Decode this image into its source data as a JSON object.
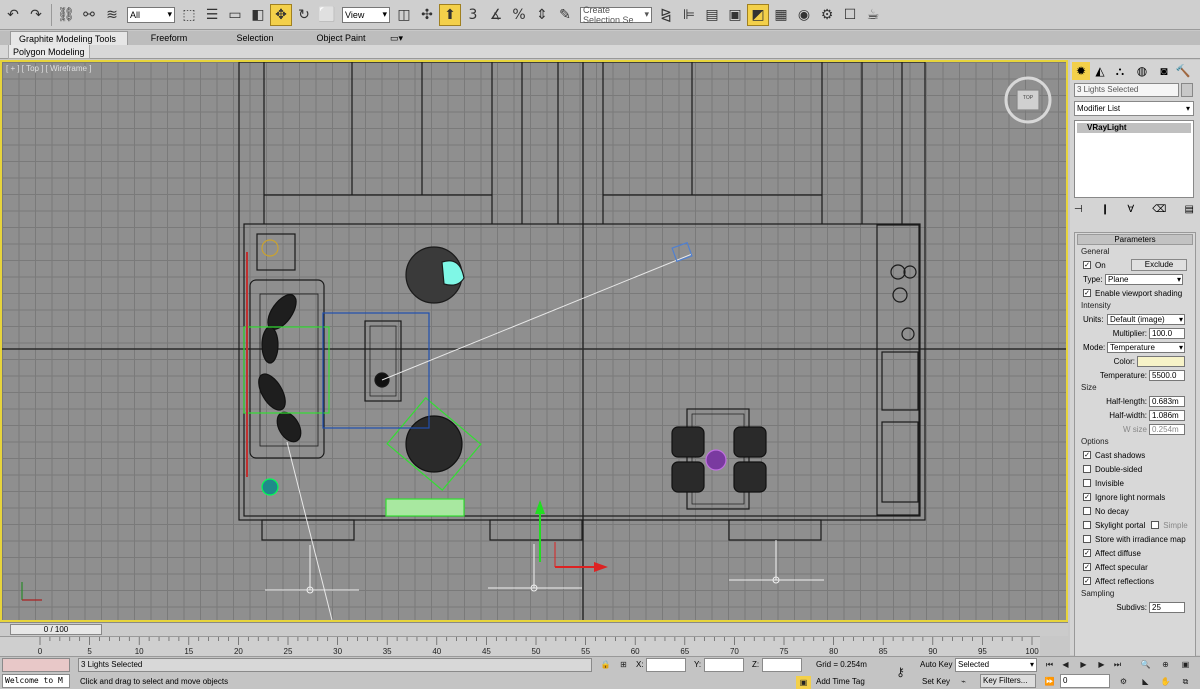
{
  "toolbar": {
    "selection_filter": "All",
    "ref_coord": "View",
    "named_selection_placeholder": "Create Selection Se",
    "snap_labels": [
      "3",
      "%"
    ]
  },
  "ribbon": {
    "tabs": [
      "Graphite Modeling Tools",
      "Freeform",
      "Selection",
      "Object Paint"
    ],
    "active_tab": "Graphite Modeling Tools",
    "sub_label": "Polygon Modeling"
  },
  "viewport": {
    "label": "[ + ] [ Top ] [ Wireframe ]",
    "viewcube_label": "TOP"
  },
  "command_panel": {
    "object_name": "3 Lights Selected",
    "modifier_list": "Modifier List",
    "stack_item": "VRayLight",
    "rollout_title": "Parameters",
    "general": {
      "title": "General",
      "on_label": "On",
      "on_checked": true,
      "exclude_label": "Exclude",
      "type_label": "Type:",
      "type_value": "Plane",
      "viewport_shading_label": "Enable viewport shading",
      "viewport_shading_checked": true
    },
    "intensity": {
      "title": "Intensity",
      "units_label": "Units:",
      "units_value": "Default (image)",
      "multiplier_label": "Multiplier:",
      "multiplier_value": "100.0",
      "mode_label": "Mode:",
      "mode_value": "Temperature",
      "color_label": "Color:",
      "color_swatch": "#f7f3c8",
      "temperature_label": "Temperature:",
      "temperature_value": "5500.0"
    },
    "size": {
      "title": "Size",
      "half_length_label": "Half-length:",
      "half_length_value": "0.683m",
      "half_width_label": "Half-width:",
      "half_width_value": "1.086m",
      "w_size_label": "W size",
      "w_size_value": "0.254m"
    },
    "options": {
      "title": "Options",
      "items": [
        {
          "label": "Cast shadows",
          "checked": true
        },
        {
          "label": "Double-sided",
          "checked": false
        },
        {
          "label": "Invisible",
          "checked": false
        },
        {
          "label": "Ignore light normals",
          "checked": true
        },
        {
          "label": "No decay",
          "checked": false
        },
        {
          "label": "Skylight portal",
          "checked": false,
          "extra": "Simple"
        },
        {
          "label": "Store with irradiance map",
          "checked": false
        },
        {
          "label": "Affect diffuse",
          "checked": true
        },
        {
          "label": "Affect specular",
          "checked": true
        },
        {
          "label": "Affect reflections",
          "checked": true
        }
      ]
    },
    "sampling": {
      "title": "Sampling",
      "subdivs_label": "Subdivs:",
      "subdivs_value": "25"
    }
  },
  "timeline": {
    "slider": "0 / 100",
    "ticks": [
      "0",
      "5",
      "10",
      "15",
      "20",
      "25",
      "30",
      "35",
      "40",
      "45",
      "50",
      "55",
      "60",
      "65",
      "70",
      "75",
      "80",
      "85",
      "90",
      "95",
      "100"
    ]
  },
  "status": {
    "listener_text": "Welcome to M",
    "selection_info": "3 Lights Selected",
    "prompt": "Click and drag to select and move objects",
    "x_label": "X:",
    "y_label": "Y:",
    "z_label": "Z:",
    "grid": "Grid = 0.254m",
    "add_time_tag": "Add Time Tag",
    "auto_key": "Auto Key",
    "set_key": "Set Key",
    "selected_dropdown": "Selected",
    "key_filters": "Key Filters...",
    "frame_value": "0"
  },
  "colors": {
    "viewport_border": "#e7d43b",
    "active_tool": "#f3d04a",
    "selection_green": "#33dd33",
    "selection_cyan": "#7ff7e6"
  }
}
